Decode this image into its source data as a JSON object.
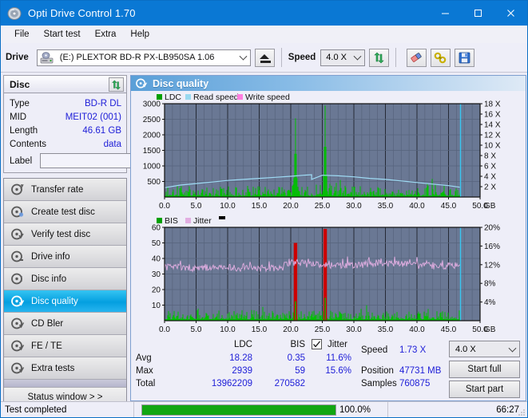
{
  "window": {
    "title": "Opti Drive Control 1.70",
    "icon": "disc-icon",
    "minimize": "—",
    "maximize": "☐",
    "close": "✕"
  },
  "menubar": {
    "items": [
      {
        "label": "File"
      },
      {
        "label": "Start test"
      },
      {
        "label": "Extra"
      },
      {
        "label": "Help"
      }
    ]
  },
  "drivebar": {
    "drive_label": "Drive",
    "drive_value": "(E:)  PLEXTOR BD-R  PX-LB950SA 1.06",
    "eject_icon": "eject-icon",
    "speed_label": "Speed",
    "speed_value": "4.0 X",
    "refresh_icon": "refresh-icon",
    "eraser_icon": "eraser-icon",
    "settings_icon": "tools-icon",
    "save_icon": "save-icon"
  },
  "disc_panel": {
    "title": "Disc",
    "refresh_icon": "refresh-icon",
    "rows": [
      {
        "key": "Type",
        "value": "BD-R DL"
      },
      {
        "key": "MID",
        "value": "MEIT02 (001)"
      },
      {
        "key": "Length",
        "value": "46.61 GB"
      },
      {
        "key": "Contents",
        "value": "data"
      }
    ],
    "label_key": "Label",
    "label_value": "",
    "label_placeholder": "",
    "disc_icon": "disc-icon"
  },
  "nav": {
    "items": [
      {
        "label": "Transfer rate",
        "icon": "disc-transfer-icon",
        "selected": false
      },
      {
        "label": "Create test disc",
        "icon": "disc-create-icon",
        "selected": false
      },
      {
        "label": "Verify test disc",
        "icon": "disc-verify-icon",
        "selected": false
      },
      {
        "label": "Drive info",
        "icon": "disc-drive-icon",
        "selected": false
      },
      {
        "label": "Disc info",
        "icon": "disc-info-icon",
        "selected": false
      },
      {
        "label": "Disc quality",
        "icon": "disc-quality-icon",
        "selected": true
      },
      {
        "label": "CD Bler",
        "icon": "disc-bler-icon",
        "selected": false
      },
      {
        "label": "FE / TE",
        "icon": "disc-fete-icon",
        "selected": false
      },
      {
        "label": "Extra tests",
        "icon": "disc-extra-icon",
        "selected": false
      }
    ],
    "status_window": "Status window > >"
  },
  "quality_panel": {
    "title": "Disc quality",
    "icon": "disc-quality-icon"
  },
  "chart_data": [
    {
      "type": "line",
      "id": "top-chart",
      "title": "",
      "legend": [
        {
          "label": "LDC",
          "color": "#00a000"
        },
        {
          "label": "Read speed",
          "color": "#99d9f0"
        },
        {
          "label": "Write speed",
          "color": "#ff7fe0"
        }
      ],
      "legend_position": "top-left",
      "xlabel": "GB",
      "ylabel": "",
      "ylabel_right": "X",
      "xlim": [
        0,
        50
      ],
      "ylim": [
        0,
        3000
      ],
      "ylim_right": [
        0,
        18
      ],
      "xticks": [
        0.0,
        5.0,
        10.0,
        15.0,
        20.0,
        25.0,
        30.0,
        35.0,
        40.0,
        45.0,
        50.0
      ],
      "xticklabels": [
        "0.0",
        "5.0",
        "10.0",
        "15.0",
        "20.0",
        "25.0",
        "30.0",
        "35.0",
        "40.0",
        "45.0",
        "50.0"
      ],
      "yticks": [
        500,
        1000,
        1500,
        2000,
        2500,
        3000
      ],
      "yticklabels": [
        "500",
        "1000",
        "1500",
        "2000",
        "2500",
        "3000"
      ],
      "yticks_right": [
        2,
        4,
        6,
        8,
        10,
        12,
        14,
        16,
        18
      ],
      "yticklabels_right": [
        "2 X",
        "4 X",
        "6 X",
        "8 X",
        "10 X",
        "12 X",
        "14 X",
        "16 X",
        "18 X"
      ],
      "grid": true,
      "plot_bg": "#6a7894",
      "series": [
        {
          "name": "LDC",
          "type": "bar",
          "color": "#00c000",
          "note": "dense noise floor ~60-250 with spikes; two large spikes",
          "spikes": [
            {
              "x": 20.75,
              "y": 2530
            },
            {
              "x": 25.45,
              "y": 2939
            }
          ],
          "baseline_avg": 110
        },
        {
          "name": "Read speed",
          "type": "line",
          "color": "#9fdcf5",
          "x": [
            0.0,
            2.5,
            5.0,
            7.5,
            10.0,
            12.5,
            15.0,
            17.5,
            20.0,
            22.0,
            23.3,
            23.3,
            25.0,
            27.5,
            30.0,
            32.5,
            35.0,
            37.5,
            40.0,
            42.5,
            45.0,
            46.8
          ],
          "y_right": [
            1.8,
            2.3,
            2.6,
            2.9,
            3.2,
            3.4,
            3.6,
            3.8,
            4.0,
            4.2,
            4.3,
            3.4,
            4.2,
            4.1,
            3.9,
            3.6,
            3.4,
            3.1,
            2.8,
            2.5,
            2.2,
            1.9
          ]
        }
      ],
      "end_marker_x": 46.9,
      "end_marker_color": "#39c6f0"
    },
    {
      "type": "line",
      "id": "bottom-chart",
      "title": "",
      "legend": [
        {
          "label": "BIS",
          "color": "#00a000"
        },
        {
          "label": "Jitter",
          "color": "#e2aee2"
        },
        {
          "label": "",
          "color": "#000000"
        }
      ],
      "legend_position": "top-left",
      "xlabel": "GB",
      "ylabel": "",
      "ylabel_right": "%",
      "xlim": [
        0,
        50
      ],
      "ylim": [
        0,
        60
      ],
      "ylim_right": [
        0,
        20
      ],
      "xticks": [
        0.0,
        5.0,
        10.0,
        15.0,
        20.0,
        25.0,
        30.0,
        35.0,
        40.0,
        45.0,
        50.0
      ],
      "xticklabels": [
        "0.0",
        "5.0",
        "10.0",
        "15.0",
        "20.0",
        "25.0",
        "30.0",
        "35.0",
        "40.0",
        "45.0",
        "50.0"
      ],
      "yticks": [
        10,
        20,
        30,
        40,
        50,
        60
      ],
      "yticklabels": [
        "10",
        "20",
        "30",
        "40",
        "50",
        "60"
      ],
      "yticks_right": [
        4,
        8,
        12,
        16,
        20
      ],
      "yticklabels_right": [
        "4%",
        "8%",
        "12%",
        "16%",
        "20%"
      ],
      "grid": true,
      "plot_bg": "#6a7894",
      "series": [
        {
          "name": "BIS",
          "type": "bar",
          "color": "#00c000",
          "baseline_avg": 2,
          "spikes": [
            {
              "x": 20.75,
              "y": 50
            },
            {
              "x": 25.45,
              "y": 59
            }
          ]
        },
        {
          "name": "Jitter",
          "type": "line",
          "color": "#e2aee2",
          "note": "noisy band around 11-13% right axis (33-39 left scale)",
          "avg_right": 11.6,
          "max_right": 15.6
        }
      ],
      "end_marker_x": 46.9,
      "end_marker_color": "#39c6f0"
    }
  ],
  "stats": {
    "col_ldc": "LDC",
    "col_bis": "BIS",
    "col_jitter": "Jitter",
    "jitter_checked": true,
    "rows": [
      {
        "key": "Avg",
        "ldc": "18.28",
        "bis": "0.35",
        "jitter": "11.6%"
      },
      {
        "key": "Max",
        "ldc": "2939",
        "bis": "59",
        "jitter": "15.6%"
      },
      {
        "key": "Total",
        "ldc": "13962209",
        "bis": "270582",
        "jitter": ""
      }
    ],
    "speed_key": "Speed",
    "speed_value": "1.73 X",
    "position_key": "Position",
    "position_value": "47731 MB",
    "samples_key": "Samples",
    "samples_value": "760875",
    "speed_select": "4.0 X",
    "start_full": "Start full",
    "start_part": "Start part"
  },
  "statusbar": {
    "message": "Test completed",
    "progress_percent": 100.0,
    "progress_text": "100.0%",
    "elapsed": "66:27"
  },
  "colors": {
    "title_bar": "#0a78d4",
    "accent_selected": "#049fe0",
    "value_blue": "#2020d8",
    "ldc_green": "#00c000",
    "bis_green": "#00c000",
    "jitter_pink": "#e2aee2",
    "read_speed_blue": "#9fdcf5",
    "write_speed_pink": "#ff7fe0",
    "spike_red": "#d00000",
    "plot_bg": "#6a7894",
    "progress_green": "#12a612"
  }
}
